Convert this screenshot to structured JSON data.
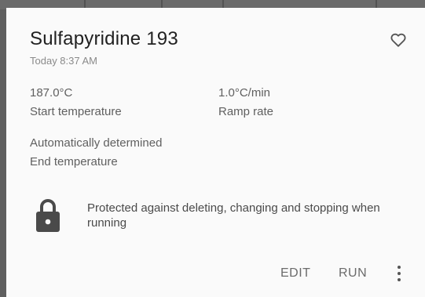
{
  "card": {
    "title": "Sulfapyridine 193",
    "timestamp": "Today 8:37 AM",
    "favorite_icon": "heart-outline-icon",
    "start_temperature": {
      "value": "187.0°C",
      "label": "Start temperature"
    },
    "ramp_rate": {
      "value": "1.0°C/min",
      "label": "Ramp rate"
    },
    "end_temperature": {
      "value": "Automatically determined",
      "label": "End temperature"
    },
    "protection": {
      "icon": "lock-icon",
      "text": "Protected against deleting, changing and stopping when running"
    },
    "actions": {
      "edit": "EDIT",
      "run": "RUN",
      "more_icon": "more-vert-icon"
    }
  },
  "colors": {
    "background": "#5f5f5f",
    "card": "#fafafa",
    "title_text": "#212121",
    "secondary_text": "#606060",
    "icon": "#4a4a4a"
  }
}
